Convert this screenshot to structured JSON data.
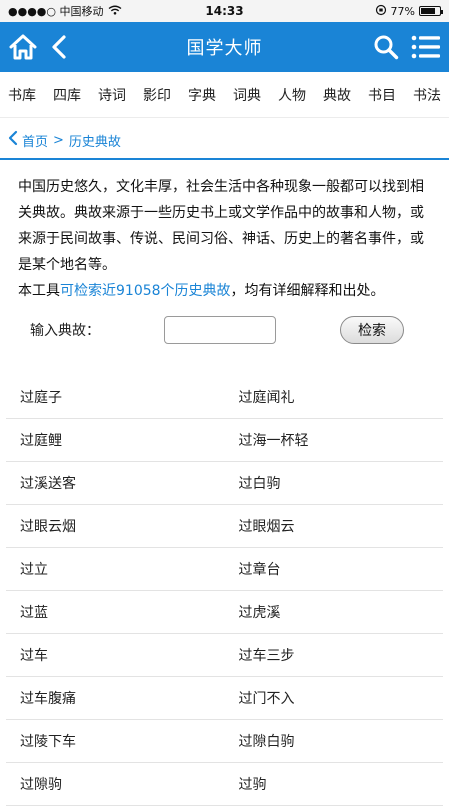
{
  "status_bar": {
    "carrier": "●●●●○ 中国移动",
    "time": "14:33",
    "battery": "77%",
    "battery_level": 0.77
  },
  "header": {
    "title": "国学大师",
    "icons": [
      "home-icon",
      "back-arrow-icon",
      "search-icon",
      "menu-icon"
    ]
  },
  "nav": {
    "categories": [
      "书库",
      "四库",
      "诗词",
      "影印",
      "字典",
      "词典",
      "人物",
      "典故",
      "书目",
      "书法"
    ]
  },
  "breadcrumb": {
    "home": "首页",
    "separator": ">",
    "current": "历史典故"
  },
  "intro": {
    "paragraph": "中国历史悠久，文化丰厚，社会生活中各种现象一般都可以找到相关典故。典故来源于一些历史书上或文学作品中的故事和人物，或来源于民间故事、传说、民间习俗、神话、历史上的著名事件，或是某个地名等。",
    "tool_prefix": "本工具",
    "tool_highlight": "可检索近91058个历史典故",
    "tool_suffix": "，均有详细解释和出处。"
  },
  "search": {
    "label": "输入典故：",
    "value": "",
    "button": "检索"
  },
  "results": [
    [
      "过庭子",
      "过庭闻礼"
    ],
    [
      "过庭鲤",
      "过海一杯轻"
    ],
    [
      "过溪送客",
      "过白驹"
    ],
    [
      "过眼云烟",
      "过眼烟云"
    ],
    [
      "过立",
      "过章台"
    ],
    [
      "过蓝",
      "过虎溪"
    ],
    [
      "过车",
      "过车三步"
    ],
    [
      "过车腹痛",
      "过门不入"
    ],
    [
      "过陵下车",
      "过隙白驹"
    ],
    [
      "过隙驹",
      "过驹"
    ]
  ],
  "colors": {
    "accent": "#1a84d6"
  }
}
